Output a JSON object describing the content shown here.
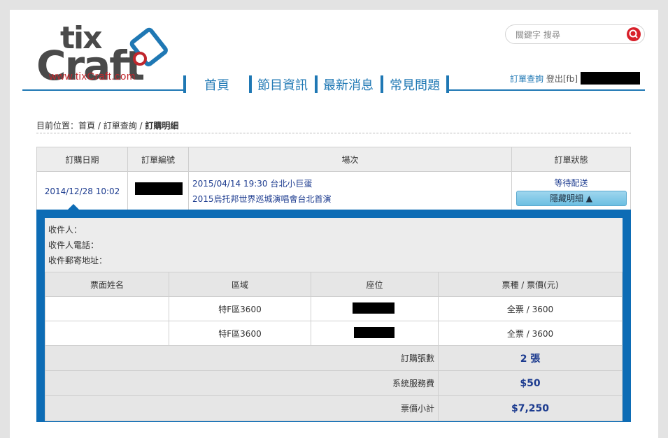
{
  "logo": {
    "name": "tixCraft",
    "url_text": "www.tixCraft.com"
  },
  "nav": [
    "首頁",
    "節目資訊",
    "最新消息",
    "常見問題"
  ],
  "search": {
    "placeholder": "關鍵字 搜尋"
  },
  "top_links": {
    "order_query": "訂單查詢",
    "login": "登出[fb]"
  },
  "breadcrumb": {
    "prefix": "目前位置：",
    "items": [
      "首頁",
      "訂單查詢",
      "訂購明細"
    ],
    "sep": " / "
  },
  "order_table": {
    "headers": [
      "訂購日期",
      "訂單編號",
      "場次",
      "訂單狀態"
    ],
    "row": {
      "date": "2014/12/28 10:02",
      "session_line1": "2015/04/14 19:30 台北小巨蛋",
      "session_line2": "2015烏托邦世界巡城演唱會台北首演",
      "status": "等待配送",
      "hide_button": "隱藏明細 ▲"
    }
  },
  "recipient": {
    "name_label": "收件人：",
    "phone_label": "收件人電話：",
    "address_label": "收件郵寄地址："
  },
  "ticket_table": {
    "headers": [
      "票面姓名",
      "區域",
      "座位",
      "票種 / 票價(元)"
    ],
    "rows": [
      {
        "name": "",
        "area": "特F區3600",
        "type": "全票 / 3600"
      },
      {
        "name": "",
        "area": "特F區3600",
        "type": "全票 / 3600"
      }
    ],
    "summary": [
      {
        "label": "訂購張數",
        "value": "2 張"
      },
      {
        "label": "系統服務費",
        "value": "$50"
      },
      {
        "label": "票價小計",
        "value": "$7,250"
      }
    ]
  },
  "colors": {
    "accent": "#1f78b4",
    "panel": "#0d6cb5",
    "brand_red": "#c0272d"
  }
}
